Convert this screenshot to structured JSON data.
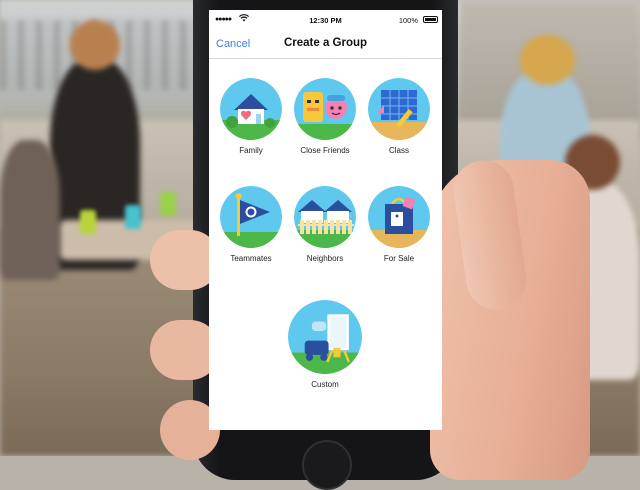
{
  "status_bar": {
    "signal": "●●●●●",
    "wifi_icon": "wifi-icon",
    "time": "12:30 PM",
    "battery": "100%"
  },
  "nav": {
    "cancel_label": "Cancel",
    "title": "Create a Group"
  },
  "groups": [
    {
      "label": "Family",
      "icon": "house-heart-icon"
    },
    {
      "label": "Close Friends",
      "icon": "friends-faces-icon"
    },
    {
      "label": "Class",
      "icon": "chalkboard-pencil-icon"
    },
    {
      "label": "Teammates",
      "icon": "pennant-flag-icon"
    },
    {
      "label": "Neighbors",
      "icon": "fence-houses-icon"
    },
    {
      "label": "For Sale",
      "icon": "price-tag-bag-icon"
    },
    {
      "label": "Custom",
      "icon": "paint-easel-icon"
    }
  ],
  "colors": {
    "accent": "#3b82e6",
    "circle_sky": "#5ec8ee",
    "grass": "#4cb84a"
  }
}
